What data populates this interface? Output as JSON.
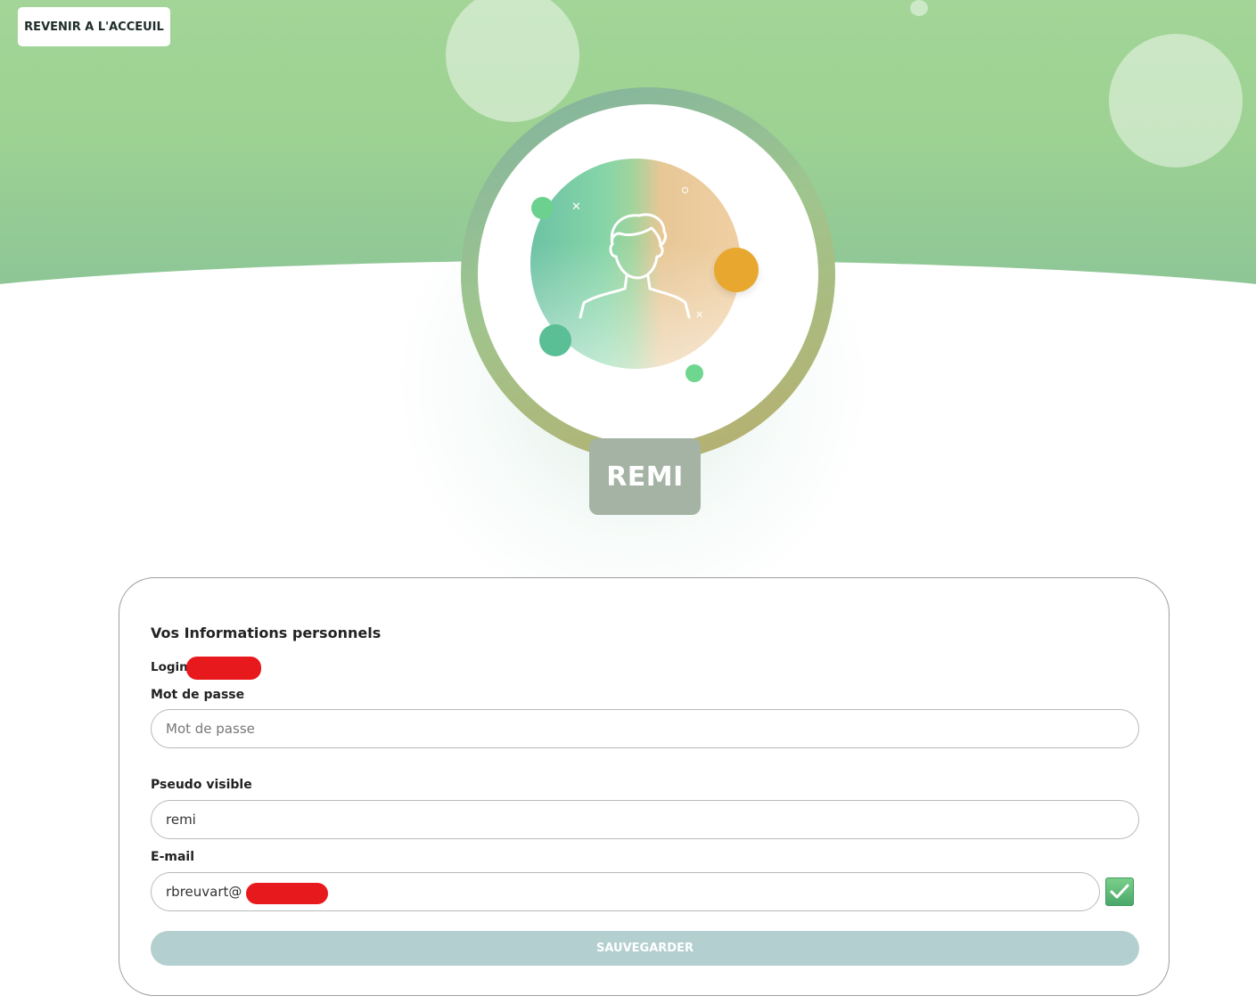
{
  "header": {
    "home_button_label": "REVENIR A L'ACCEUIL"
  },
  "profile": {
    "display_name": "REMI",
    "avatar_icon": "user-avatar-icon"
  },
  "form": {
    "section_title": "Vos Informations personnels",
    "login_label": "Login",
    "password_label": "Mot de passe",
    "password_placeholder": "Mot de passe",
    "password_value": "",
    "pseudo_label": "Pseudo visible",
    "pseudo_value": "remi",
    "email_label": "E-mail",
    "email_value": "rbreuvart@",
    "email_verified_icon": "checkmark-icon",
    "save_label": "SAUVEGARDER"
  },
  "colors": {
    "hero_green": "#9dd293",
    "accent_orange": "#e8a830",
    "save_button": "#b4cfcf",
    "name_badge": "#a4b3a4"
  }
}
